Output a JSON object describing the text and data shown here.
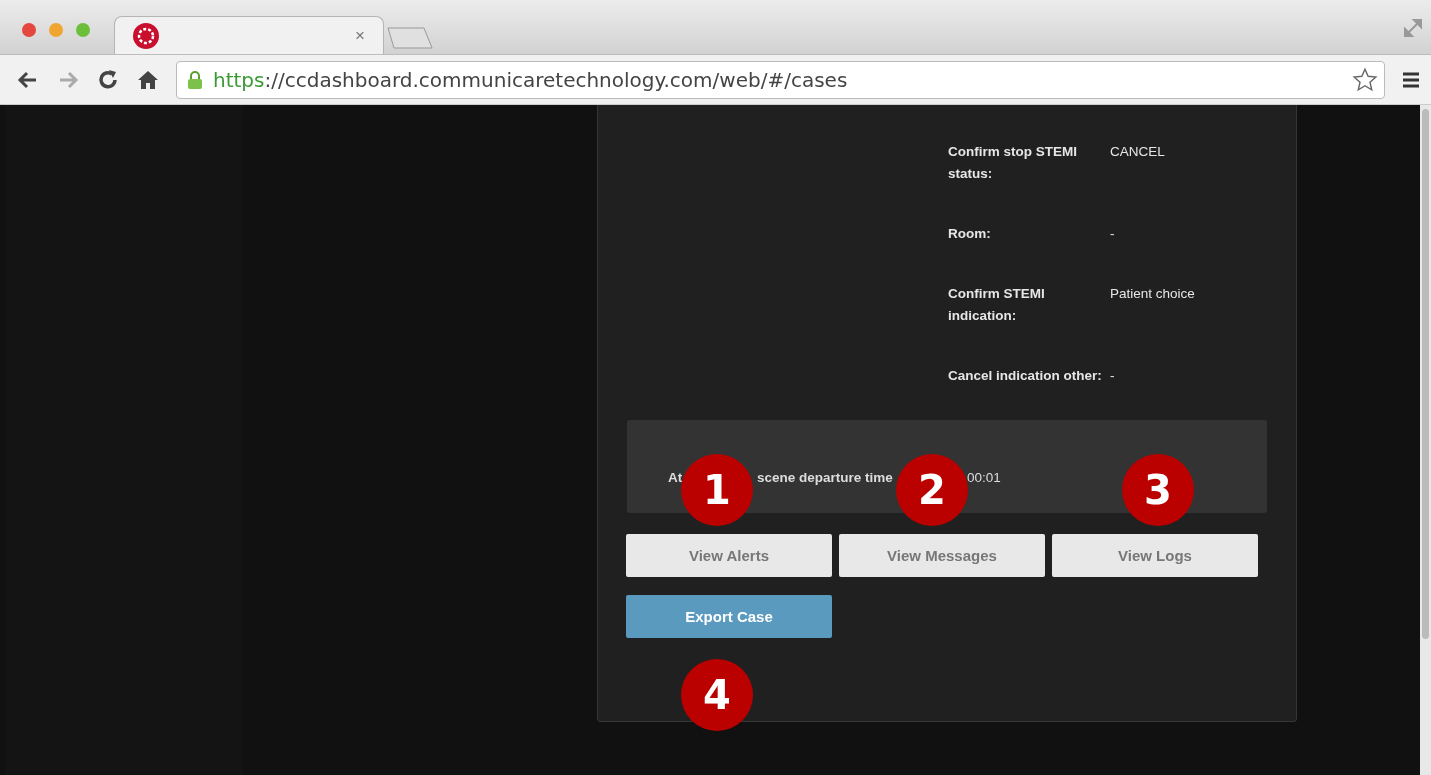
{
  "browser": {
    "tab": {
      "close": "×",
      "selected": true
    },
    "address": {
      "scheme": "https",
      "rest": "://ccdashboard.communicaretechnology.com/web/#/cases"
    }
  },
  "details": [
    {
      "label": "Confirm stop STEMI status:",
      "value": "CANCEL"
    },
    {
      "label": "Room:",
      "value": "-"
    },
    {
      "label": "Confirm STEMI indication:",
      "value": "Patient choice"
    },
    {
      "label": "Cancel indication other:",
      "value": "-"
    }
  ],
  "timer_panel": {
    "parts": [
      "At",
      "scene departure time",
      "00:01"
    ]
  },
  "buttons": [
    {
      "label": "View Alerts",
      "kind": "default"
    },
    {
      "label": "View Messages",
      "kind": "default"
    },
    {
      "label": "View Logs",
      "kind": "default"
    },
    {
      "label": "Export Case",
      "kind": "primary"
    }
  ],
  "callouts": [
    "1",
    "2",
    "3",
    "4"
  ]
}
